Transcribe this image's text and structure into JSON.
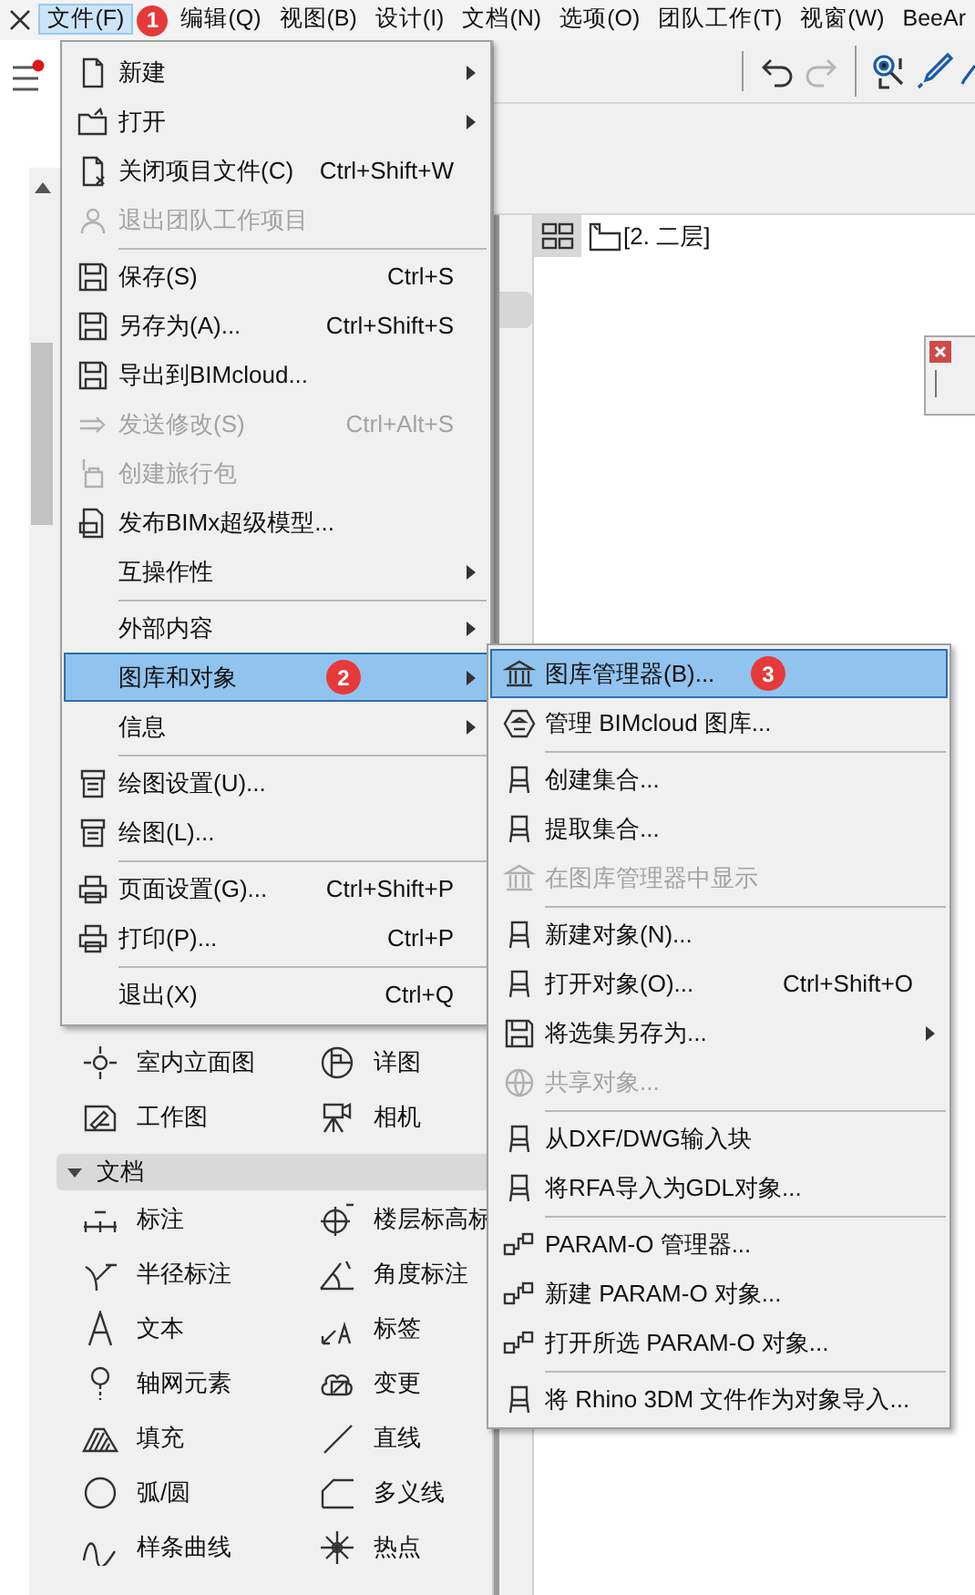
{
  "menubar": [
    {
      "label": "文件(F)",
      "selected": true,
      "badge": "1"
    },
    {
      "label": "编辑(Q)",
      "selected": false
    },
    {
      "label": "视图(B)",
      "selected": false
    },
    {
      "label": "设计(I)",
      "selected": false
    },
    {
      "label": "文档(N)",
      "selected": false
    },
    {
      "label": "选项(O)",
      "selected": false
    },
    {
      "label": "团队工作(T)",
      "selected": false
    },
    {
      "label": "视窗(W)",
      "selected": false
    },
    {
      "label": "BeeAr",
      "selected": false
    }
  ],
  "file_menu": {
    "items": [
      {
        "kind": "item",
        "label": "新建",
        "disabled": false,
        "selected": false,
        "submenu": true
      },
      {
        "kind": "item",
        "label": "打开",
        "disabled": false,
        "selected": false,
        "submenu": true
      },
      {
        "kind": "item",
        "label": "关闭项目文件(C)",
        "shortcut": "Ctrl+Shift+W",
        "disabled": false,
        "selected": false,
        "submenu": false
      },
      {
        "kind": "item",
        "label": "退出团队工作项目",
        "disabled": true,
        "selected": false,
        "submenu": false
      },
      {
        "kind": "separator"
      },
      {
        "kind": "item",
        "label": "保存(S)",
        "shortcut": "Ctrl+S",
        "disabled": false,
        "selected": false,
        "submenu": false
      },
      {
        "kind": "item",
        "label": "另存为(A)...",
        "shortcut": "Ctrl+Shift+S",
        "disabled": false,
        "selected": false,
        "submenu": false
      },
      {
        "kind": "item",
        "label": "导出到BIMcloud...",
        "disabled": false,
        "selected": false,
        "submenu": false
      },
      {
        "kind": "item",
        "label": "发送修改(S)",
        "shortcut": "Ctrl+Alt+S",
        "disabled": true,
        "selected": false,
        "submenu": false
      },
      {
        "kind": "item",
        "label": "创建旅行包",
        "disabled": true,
        "selected": false,
        "submenu": false
      },
      {
        "kind": "item",
        "label": "发布BIMx超级模型...",
        "disabled": false,
        "selected": false,
        "submenu": false
      },
      {
        "kind": "item",
        "label": "互操作性",
        "disabled": false,
        "selected": false,
        "submenu": true
      },
      {
        "kind": "separator"
      },
      {
        "kind": "item",
        "label": "外部内容",
        "disabled": false,
        "selected": false,
        "submenu": true
      },
      {
        "kind": "item",
        "label": "图库和对象",
        "disabled": false,
        "selected": true,
        "submenu": true,
        "badge": "2"
      },
      {
        "kind": "item",
        "label": "信息",
        "disabled": false,
        "selected": false,
        "submenu": true
      },
      {
        "kind": "separator"
      },
      {
        "kind": "item",
        "label": "绘图设置(U)...",
        "disabled": false,
        "selected": false,
        "submenu": false
      },
      {
        "kind": "item",
        "label": "绘图(L)...",
        "disabled": false,
        "selected": false,
        "submenu": false
      },
      {
        "kind": "separator"
      },
      {
        "kind": "item",
        "label": "页面设置(G)...",
        "shortcut": "Ctrl+Shift+P",
        "disabled": false,
        "selected": false,
        "submenu": false
      },
      {
        "kind": "item",
        "label": "打印(P)...",
        "shortcut": "Ctrl+P",
        "disabled": false,
        "selected": false,
        "submenu": false
      },
      {
        "kind": "separator"
      },
      {
        "kind": "item",
        "label": "退出(X)",
        "shortcut": "Ctrl+Q",
        "disabled": false,
        "selected": false,
        "submenu": false
      }
    ]
  },
  "library_submenu": {
    "items": [
      {
        "kind": "item",
        "label": "图库管理器(B)...",
        "disabled": false,
        "selected": true,
        "submenu": false,
        "badge": "3"
      },
      {
        "kind": "item",
        "label": "管理 BIMcloud 图库...",
        "disabled": false,
        "selected": false,
        "submenu": false
      },
      {
        "kind": "separator"
      },
      {
        "kind": "item",
        "label": "创建集合...",
        "disabled": false,
        "selected": false,
        "submenu": false
      },
      {
        "kind": "item",
        "label": "提取集合...",
        "disabled": false,
        "selected": false,
        "submenu": false
      },
      {
        "kind": "item",
        "label": "在图库管理器中显示",
        "disabled": true,
        "selected": false,
        "submenu": false
      },
      {
        "kind": "separator"
      },
      {
        "kind": "item",
        "label": "新建对象(N)...",
        "disabled": false,
        "selected": false,
        "submenu": false
      },
      {
        "kind": "item",
        "label": "打开对象(O)...",
        "shortcut": "Ctrl+Shift+O",
        "disabled": false,
        "selected": false,
        "submenu": false
      },
      {
        "kind": "item",
        "label": "将选集另存为...",
        "disabled": false,
        "selected": false,
        "submenu": true
      },
      {
        "kind": "item",
        "label": "共享对象...",
        "disabled": true,
        "selected": false,
        "submenu": false
      },
      {
        "kind": "separator"
      },
      {
        "kind": "item",
        "label": "从DXF/DWG输入块",
        "disabled": false,
        "selected": false,
        "submenu": false
      },
      {
        "kind": "item",
        "label": "将RFA导入为GDL对象...",
        "disabled": false,
        "selected": false,
        "submenu": false
      },
      {
        "kind": "separator"
      },
      {
        "kind": "item",
        "label": "PARAM-O 管理器...",
        "disabled": false,
        "selected": false,
        "submenu": false
      },
      {
        "kind": "item",
        "label": "新建 PARAM-O 对象...",
        "disabled": false,
        "selected": false,
        "submenu": false
      },
      {
        "kind": "item",
        "label": "打开所选 PARAM-O 对象...",
        "disabled": false,
        "selected": false,
        "submenu": false
      },
      {
        "kind": "separator"
      },
      {
        "kind": "item",
        "label": "将 Rhino 3DM 文件作为对象导入...",
        "disabled": false,
        "selected": false,
        "submenu": false
      }
    ]
  },
  "view_tab": {
    "label": "[2. 二层]"
  },
  "toolbox": {
    "tools": [
      {
        "label": "室内立面图"
      },
      {
        "label": "详图"
      },
      {
        "label": "工作图"
      },
      {
        "label": "相机"
      }
    ],
    "sections": [
      {
        "title": "文档",
        "expanded": true,
        "tools": [
          {
            "label": "标注"
          },
          {
            "label": "楼层标高标"
          },
          {
            "label": "半径标注"
          },
          {
            "label": "角度标注"
          },
          {
            "label": "文本"
          },
          {
            "label": "标签"
          },
          {
            "label": "轴网元素"
          },
          {
            "label": "变更"
          },
          {
            "label": "填充"
          },
          {
            "label": "直线"
          },
          {
            "label": "弧/圆"
          },
          {
            "label": "多义线"
          },
          {
            "label": "样条曲线"
          },
          {
            "label": "热点"
          }
        ]
      }
    ]
  }
}
